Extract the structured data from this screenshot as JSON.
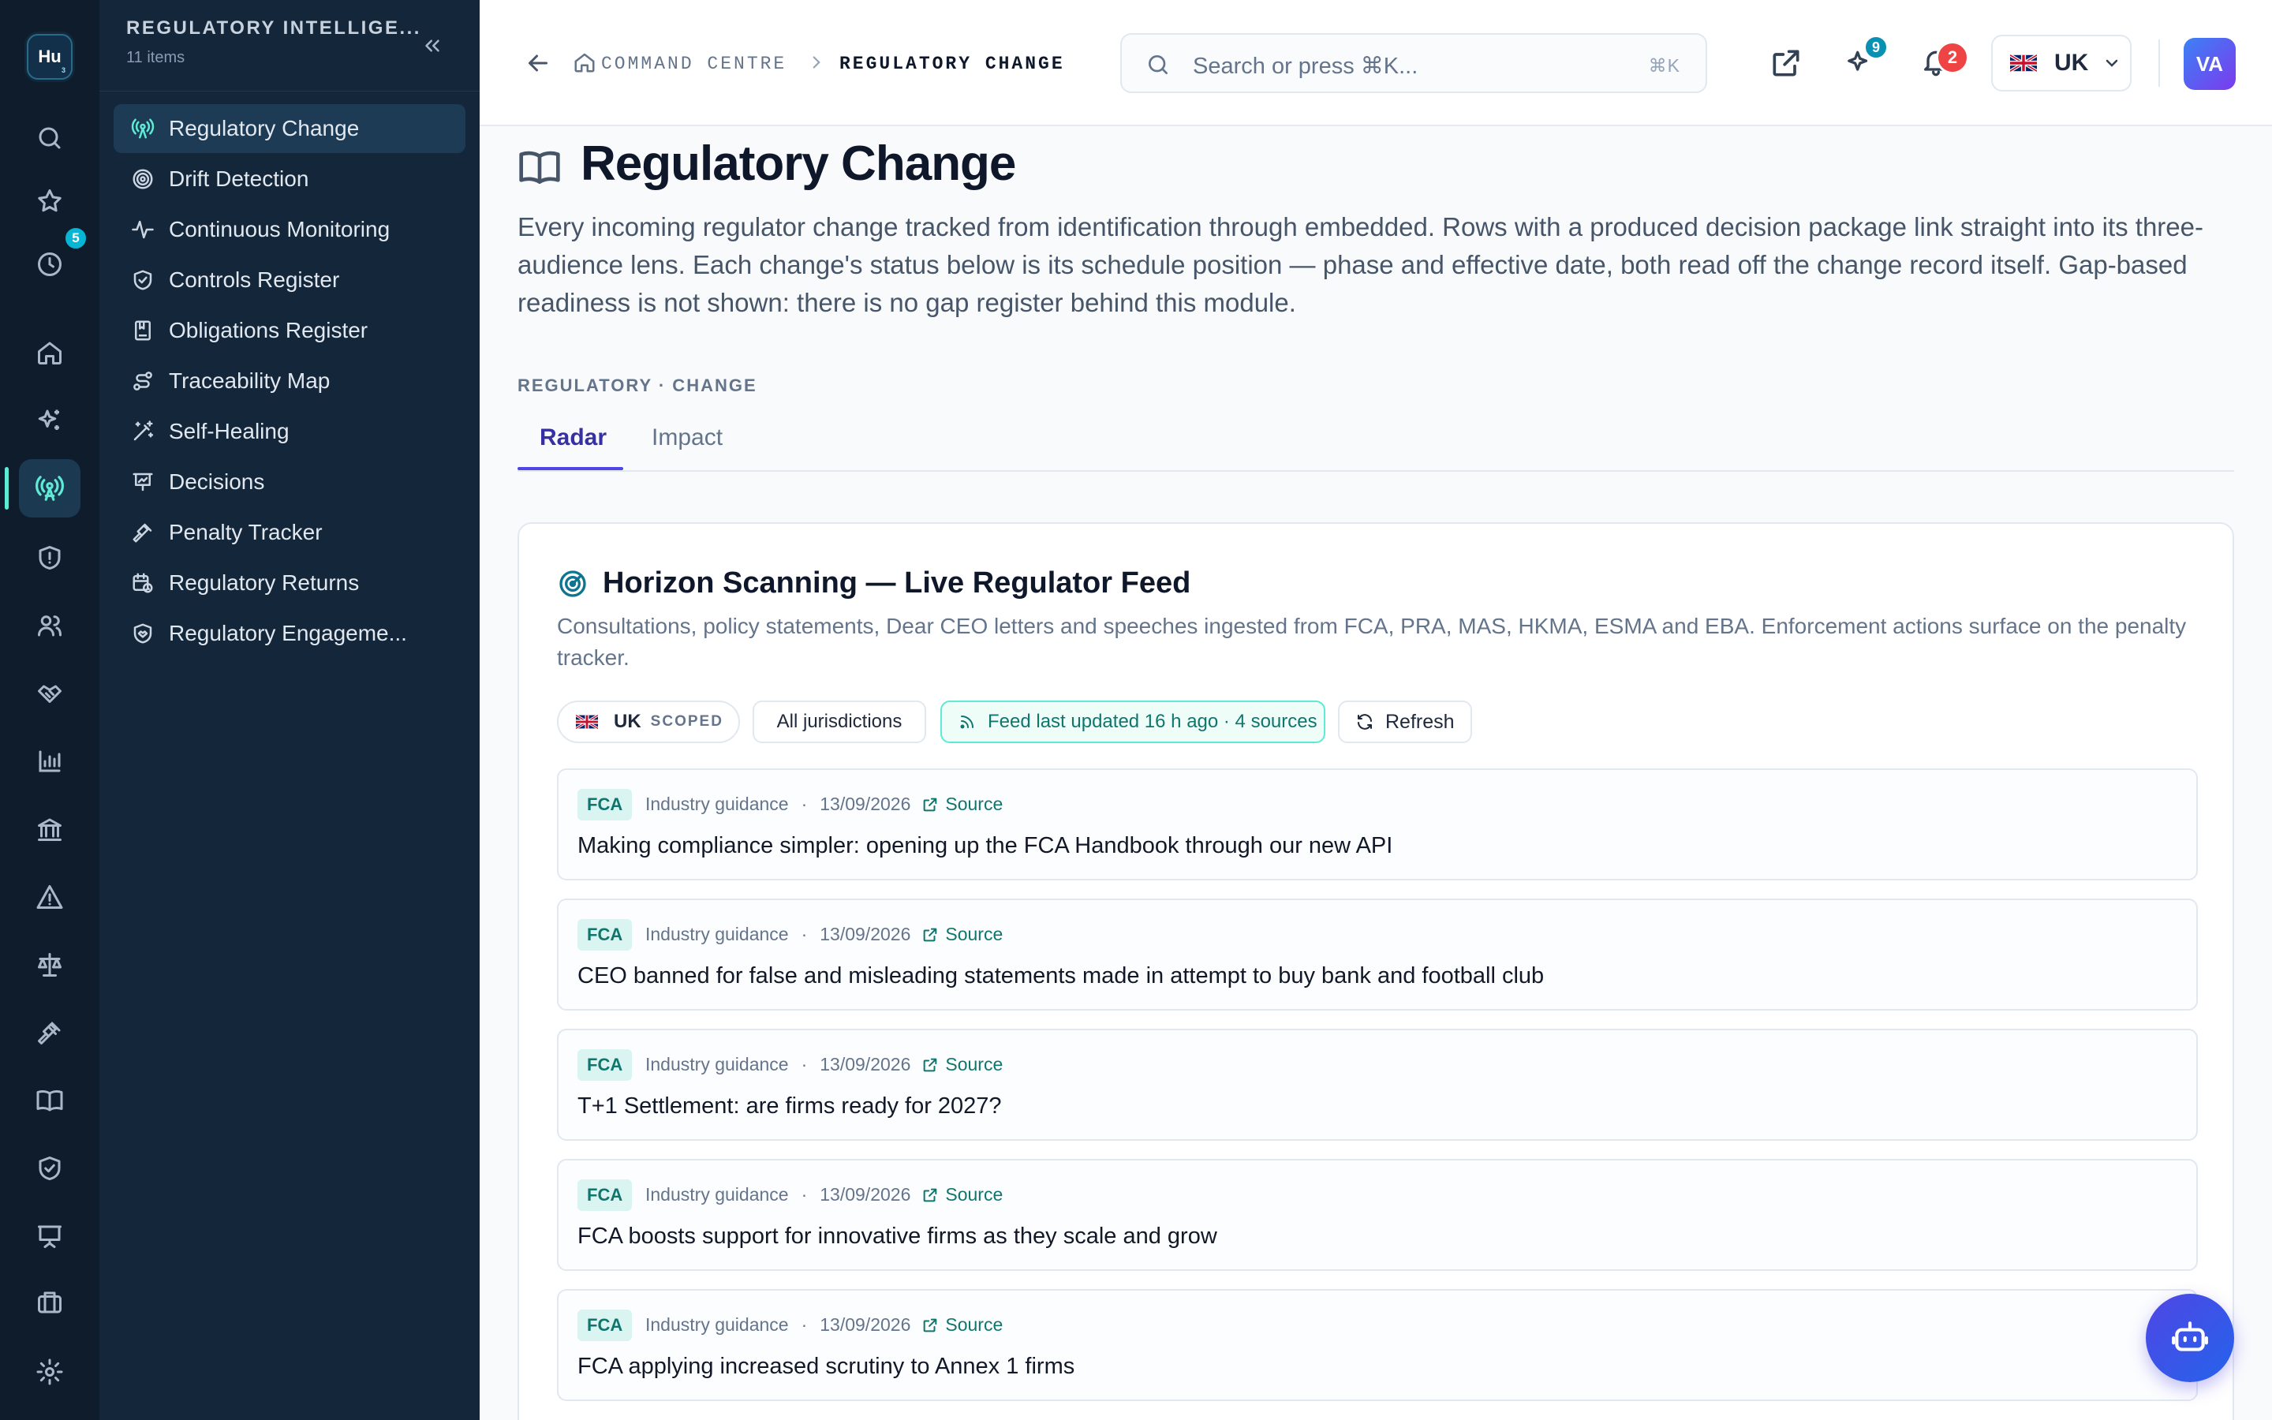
{
  "rail": {
    "logo_text": "Hu",
    "logo_sub": "3",
    "history_badge": "5"
  },
  "sidebar": {
    "title": "REGULATORY INTELLIGE...",
    "count": "11 items",
    "items": [
      {
        "label": "Regulatory Change",
        "icon": "radio-tower-icon",
        "active": true
      },
      {
        "label": "Drift Detection",
        "icon": "target-icon"
      },
      {
        "label": "Continuous Monitoring",
        "icon": "activity-icon"
      },
      {
        "label": "Controls Register",
        "icon": "shield-check-icon"
      },
      {
        "label": "Obligations Register",
        "icon": "book-bookmark-icon"
      },
      {
        "label": "Traceability Map",
        "icon": "route-icon"
      },
      {
        "label": "Self-Healing",
        "icon": "magic-wand-icon"
      },
      {
        "label": "Decisions",
        "icon": "presentation-icon"
      },
      {
        "label": "Penalty Tracker",
        "icon": "gavel-icon"
      },
      {
        "label": "Regulatory Returns",
        "icon": "calendar-clock-icon"
      },
      {
        "label": "Regulatory Engageme...",
        "icon": "shield-handshake-icon"
      }
    ]
  },
  "header": {
    "breadcrumb_parent": "COMMAND CENTRE",
    "breadcrumb_current": "REGULATORY CHANGE",
    "search_placeholder": "Search or press ⌘K...",
    "search_shortcut": "⌘K",
    "sparkle_badge": "9",
    "notification_badge": "2",
    "region": "UK",
    "avatar_initials": "VA"
  },
  "page": {
    "title": "Regulatory Change",
    "description": "Every incoming regulator change tracked from identification through embedded. Rows with a produced decision package link straight into its three-audience lens. Each change's status below is its schedule position — phase and effective date, both read off the change record itself. Gap-based readiness is not shown: there is no gap register behind this module.",
    "section_label": "REGULATORY · CHANGE",
    "tabs": [
      {
        "label": "Radar",
        "active": true
      },
      {
        "label": "Impact",
        "active": false
      }
    ]
  },
  "feed": {
    "title": "Horizon Scanning — Live Regulator Feed",
    "description": "Consultations, policy statements, Dear CEO letters and speeches ingested from FCA, PRA, MAS, HKMA, ESMA and EBA. Enforcement actions surface on the penalty tracker.",
    "chip_region": "UK",
    "chip_scoped": "SCOPED",
    "chip_all": "All jurisdictions",
    "chip_status": "Feed last updated 16 h ago · 4 sources",
    "refresh_label": "Refresh",
    "items": [
      {
        "regulator": "FCA",
        "category": "Industry guidance",
        "date": "13/09/2026",
        "link": "Source",
        "title": "Making compliance simpler: opening up the FCA Handbook through our new API"
      },
      {
        "regulator": "FCA",
        "category": "Industry guidance",
        "date": "13/09/2026",
        "link": "Source",
        "title": "CEO banned for false and misleading statements made in attempt to buy bank and football club"
      },
      {
        "regulator": "FCA",
        "category": "Industry guidance",
        "date": "13/09/2026",
        "link": "Source",
        "title": "T+1 Settlement: are firms ready for 2027?"
      },
      {
        "regulator": "FCA",
        "category": "Industry guidance",
        "date": "13/09/2026",
        "link": "Source",
        "title": "FCA boosts support for innovative firms as they scale and grow"
      },
      {
        "regulator": "FCA",
        "category": "Industry guidance",
        "date": "13/09/2026",
        "link": "Source",
        "title": "FCA applying increased scrutiny to Annex 1 firms"
      }
    ]
  },
  "colors": {
    "accent": "#4f46e5",
    "teal": "#0f766e",
    "rail_bg": "#0f1c2b",
    "sidebar_bg": "#13263a"
  }
}
